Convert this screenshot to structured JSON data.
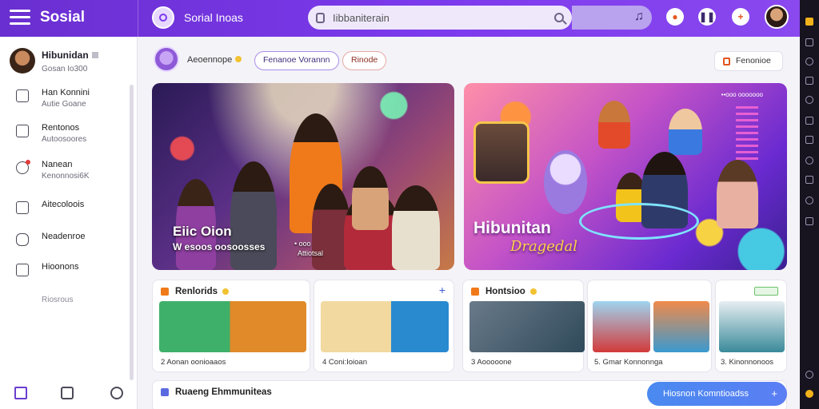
{
  "app": {
    "brand": "Sosial",
    "name": "Sorial Inoas"
  },
  "search": {
    "value": "Iibbaniterain"
  },
  "colors": {
    "primary": "#7c3aed",
    "accent_blue": "#4a8af0",
    "gold": "#f1c232"
  },
  "profile": {
    "name": "Hibunidan",
    "sub": "Gosan Io300"
  },
  "sidebar": {
    "items": [
      {
        "title": "Han Konnini",
        "sub": "Autie Goane",
        "icon": "pen-icon"
      },
      {
        "title": "Rentonos",
        "sub": "Autoosoores",
        "icon": "note-icon"
      },
      {
        "title": "Nanean",
        "sub": "Kenonnosi6K",
        "icon": "heart-icon"
      },
      {
        "title": "Aitecoloois",
        "sub": "",
        "icon": "document-icon"
      },
      {
        "title": "Neadenroe",
        "sub": "",
        "icon": "cart-icon"
      },
      {
        "title": "Hioonons",
        "sub": "",
        "icon": "monitor-icon"
      }
    ],
    "muted": "Riosrous"
  },
  "subbar": {
    "label": "Aeoennope",
    "chip1": "Fenanoe Vorannn",
    "chip2": "Rinode",
    "follow": "Fenonioe"
  },
  "hero_left": {
    "title": "Eiic Oion",
    "subtitle": "W esoos oosoosses",
    "tag1": "• ooo",
    "tag2": "Attiotsal"
  },
  "hero_right": {
    "title": "Hibunitan",
    "subtitle": "Dragedal",
    "tag": "••ooo ooooooo"
  },
  "cards": {
    "card1": {
      "title": "Renlorids",
      "cap1": "2 Aonan oonioaaos",
      "cap2": "4 Coni:Ioioan"
    },
    "card2": {
      "title": "Hontsioo",
      "cap1": "3 Aooooone",
      "cap2": "5. Gmar Konnonnga",
      "cap3": "3. Kinonnonoos"
    },
    "card3": {
      "title": "Ruaeng Ehmmuniteas"
    }
  },
  "cta": {
    "label": "Hiosnon Komntioadss",
    "arrow": "+"
  }
}
